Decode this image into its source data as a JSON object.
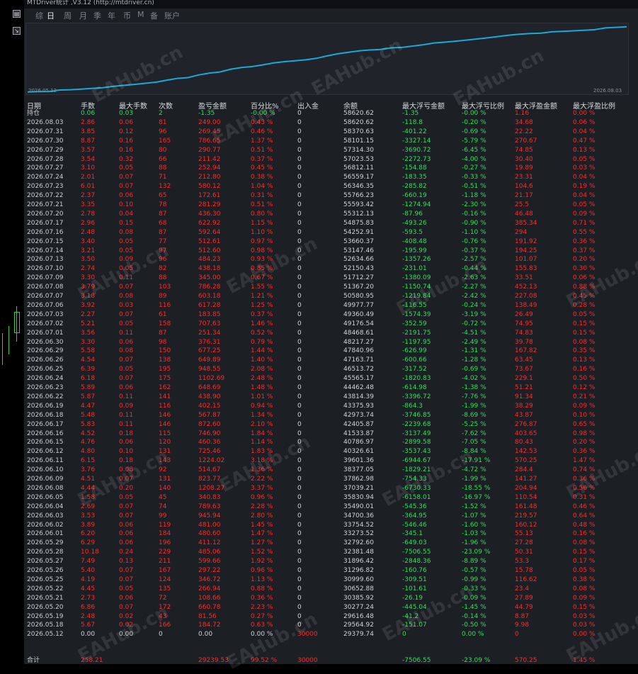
{
  "window": {
    "title": "MTDriver统计 ,V3.12 (http://mtdriver.cn)"
  },
  "tabs": [
    "综",
    "日",
    "周",
    "月",
    "季",
    "年",
    "币",
    "M",
    "备",
    "账户"
  ],
  "active_tab": "日",
  "chart": {
    "start_label": "2026.05.12",
    "end_label": "2026.08.03",
    "line_color": "#1aa9d6"
  },
  "columns": [
    "日期",
    "手数",
    "最大手数",
    "次数",
    "盈亏金额",
    "百分比%",
    "出入金",
    "余额",
    "最大浮亏金额",
    "最大浮亏比例",
    "最大浮盈金额",
    "最大浮盈比例"
  ],
  "holding": {
    "label": "持仓",
    "lots": "0.06",
    "max_lots": "0.03",
    "count": "2",
    "pnl": "-1.35",
    "pct": "-0.00 %",
    "io": "0",
    "balance": "58620.62",
    "max_float_loss": "-1.35",
    "max_float_loss_pct": "-0.00 %",
    "max_float_profit": "1.16",
    "max_float_profit_pct": "0.00 %"
  },
  "rows": [
    [
      "2026.08.03",
      "2.86",
      "0.06",
      "81",
      "249.00",
      "0.43 %",
      "0",
      "58620.62",
      "-118.8",
      "-0.20 %",
      "34.68",
      "0.06 %"
    ],
    [
      "2026.07.31",
      "3.85",
      "0.12",
      "96",
      "269.45",
      "0.46 %",
      "0",
      "58370.63",
      "-401.22",
      "-0.69 %",
      "22.22",
      "0.04 %"
    ],
    [
      "2026.07.30",
      "8.87",
      "0.16",
      "165",
      "786.65",
      "1.37 %",
      "0",
      "58101.15",
      "-3327.14",
      "-5.79 %",
      "270.67",
      "0.47 %"
    ],
    [
      "2026.07.29",
      "3.57",
      "0.16",
      "80",
      "290.77",
      "0.51 %",
      "0",
      "57314.30",
      "-3690.72",
      "-6.45 %",
      "74.85",
      "0.13 %"
    ],
    [
      "2026.07.28",
      "3.54",
      "0.32",
      "66",
      "211.42",
      "0.37 %",
      "0",
      "57023.53",
      "-2272.73",
      "-4.00 %",
      "30.40",
      "0.05 %"
    ],
    [
      "2026.07.27",
      "3.10",
      "0.05",
      "88",
      "252.94",
      "0.45 %",
      "0",
      "56812.11",
      "-154.88",
      "-0.27 %",
      "19.89",
      "0.03 %"
    ],
    [
      "2026.07.24",
      "2.01",
      "0.07",
      "71",
      "212.80",
      "0.38 %",
      "0",
      "56559.17",
      "-183.35",
      "-0.33 %",
      "23.31",
      "0.04 %"
    ],
    [
      "2026.07.23",
      "6.01",
      "0.07",
      "132",
      "580.12",
      "1.04 %",
      "0",
      "56346.35",
      "-285.82",
      "-0.51 %",
      "104.6",
      "0.19 %"
    ],
    [
      "2026.07.22",
      "2.37",
      "0.06",
      "65",
      "172.61",
      "0.31 %",
      "0",
      "55766.23",
      "-660.19",
      "-1.18 %",
      "21.17",
      "0.04 %"
    ],
    [
      "2026.07.21",
      "3.35",
      "0.10",
      "78",
      "281.29",
      "0.51 %",
      "0",
      "55593.42",
      "-1274.94",
      "-2.30 %",
      "25.5",
      "0.05 %"
    ],
    [
      "2026.07.20",
      "2.78",
      "0.04",
      "87",
      "436.30",
      "0.80 %",
      "0",
      "55312.13",
      "-87.96",
      "-0.16 %",
      "46.48",
      "0.09 %"
    ],
    [
      "2026.07.17",
      "2.96",
      "0.15",
      "68",
      "622.92",
      "1.15 %",
      "0",
      "54875.83",
      "-493.26",
      "-0.90 %",
      "385.34",
      "0.71 %"
    ],
    [
      "2026.07.16",
      "2.48",
      "0.08",
      "87",
      "592.64",
      "1.10 %",
      "0",
      "54252.91",
      "-593.5",
      "-1.10 %",
      "294",
      "0.55 %"
    ],
    [
      "2026.07.15",
      "3.40",
      "0.05",
      "77",
      "512.61",
      "0.97 %",
      "0",
      "53660.37",
      "-408.48",
      "-0.76 %",
      "191.92",
      "0.36 %"
    ],
    [
      "2026.07.14",
      "3.21",
      "0.05",
      "97",
      "512.60",
      "0.98 %",
      "0",
      "53147.46",
      "-195.99",
      "-0.37 %",
      "194.25",
      "0.37 %"
    ],
    [
      "2026.07.13",
      "3.50",
      "0.09",
      "96",
      "484.23",
      "0.93 %",
      "0",
      "52634.66",
      "-1357.26",
      "-2.57 %",
      "101.07",
      "0.20 %"
    ],
    [
      "2026.07.10",
      "2.74",
      "0.05",
      "82",
      "438.18",
      "0.85 %",
      "0",
      "52150.43",
      "-231.01",
      "-0.44 %",
      "155.83",
      "0.30 %"
    ],
    [
      "2026.07.09",
      "3.30",
      "0.11",
      "88",
      "345.00",
      "0.67 %",
      "0",
      "51712.27",
      "-1380.09",
      "-2.63 %",
      "33.51",
      "0.06 %"
    ],
    [
      "2026.07.08",
      "3.79",
      "0.07",
      "103",
      "786.28",
      "1.55 %",
      "0",
      "51367.20",
      "-1150.74",
      "-2.27 %",
      "452.13",
      "0.88 %"
    ],
    [
      "2026.07.07",
      "3.18",
      "0.08",
      "89",
      "603.18",
      "1.21 %",
      "0",
      "50580.95",
      "-1219.84",
      "-2.42 %",
      "227.08",
      "0.45 %"
    ],
    [
      "2026.07.06",
      "3.92",
      "0.03",
      "116",
      "617.28",
      "1.25 %",
      "0",
      "49977.77",
      "-116.55",
      "-0.24 %",
      "138.49",
      "0.28 %"
    ],
    [
      "2026.07.03",
      "2.27",
      "0.07",
      "61",
      "183.85",
      "0.37 %",
      "0",
      "49360.49",
      "-1574.39",
      "-3.19 %",
      "26.49",
      "0.05 %"
    ],
    [
      "2026.07.02",
      "5.21",
      "0.05",
      "158",
      "707.63",
      "1.46 %",
      "0",
      "49176.54",
      "-352.59",
      "-0.72 %",
      "74.95",
      "0.15 %"
    ],
    [
      "2026.07.01",
      "3.56",
      "0.11",
      "87",
      "251.34",
      "0.52 %",
      "0",
      "48468.61",
      "-2191.75",
      "-4.51 %",
      "74.83",
      "0.15 %"
    ],
    [
      "2026.06.30",
      "3.30",
      "0.06",
      "98",
      "376.31",
      "0.79 %",
      "0",
      "48217.27",
      "-1197.95",
      "-2.49 %",
      "39.78",
      "0.08 %"
    ],
    [
      "2026.06.29",
      "5.58",
      "0.08",
      "150",
      "677.25",
      "1.44 %",
      "0",
      "47840.96",
      "-626.99",
      "-1.31 %",
      "167.82",
      "0.35 %"
    ],
    [
      "2026.06.26",
      "4.54",
      "0.07",
      "138",
      "649.89",
      "1.40 %",
      "0",
      "47163.71",
      "-600.66",
      "-1.28 %",
      "63.45",
      "0.13 %"
    ],
    [
      "2026.06.25",
      "6.39",
      "0.05",
      "195",
      "948.55",
      "2.08 %",
      "0",
      "46513.72",
      "-317.52",
      "-0.69 %",
      "73.67",
      "0.16 %"
    ],
    [
      "2026.06.24",
      "6.18",
      "0.07",
      "175",
      "1102.69",
      "2.48 %",
      "0",
      "45565.17",
      "-1820.83",
      "-4.02 %",
      "229.1",
      "0.50 %"
    ],
    [
      "2026.06.23",
      "5.89",
      "0.06",
      "162",
      "648.69",
      "1.48 %",
      "0",
      "44462.48",
      "-614.98",
      "-1.38 %",
      "51.21",
      "0.12 %"
    ],
    [
      "2026.06.22",
      "5.87",
      "0.11",
      "141",
      "438.90",
      "1.01 %",
      "0",
      "43814.39",
      "-3396.72",
      "-7.76 %",
      "91.34",
      "0.21 %"
    ],
    [
      "2026.06.19",
      "4.47",
      "0.09",
      "116",
      "402.15",
      "0.94 %",
      "0",
      "43375.93",
      "-864.3",
      "-1.99 %",
      "38.29",
      "0.09 %"
    ],
    [
      "2026.06.18",
      "5.48",
      "0.11",
      "146",
      "567.87",
      "1.34 %",
      "0",
      "42973.74",
      "-3746.85",
      "-8.69 %",
      "43.87",
      "0.10 %"
    ],
    [
      "2026.06.17",
      "5.83",
      "0.11",
      "146",
      "872.60",
      "2.10 %",
      "0",
      "42405.87",
      "-2239.68",
      "-5.25 %",
      "276.87",
      "0.65 %"
    ],
    [
      "2026.06.16",
      "4.52",
      "0.18",
      "115",
      "746.90",
      "1.84 %",
      "0",
      "41533.87",
      "-3137.49",
      "-7.62 %",
      "403.65",
      "0.98 %"
    ],
    [
      "2026.06.15",
      "4.76",
      "0.06",
      "120",
      "460.36",
      "1.14 %",
      "0",
      "40786.97",
      "-2899.58",
      "-7.05 %",
      "80.43",
      "0.20 %"
    ],
    [
      "2026.06.12",
      "4.80",
      "0.10",
      "131",
      "725.46",
      "1.83 %",
      "0",
      "40326.61",
      "-3537.43",
      "-8.84 %",
      "142.53",
      "0.36 %"
    ],
    [
      "2026.06.11",
      "6.15",
      "0.18",
      "143",
      "1224.02",
      "3.18 %",
      "0",
      "39601.36",
      "-6944.67",
      "-17.91 %",
      "570.25",
      "1.47 %"
    ],
    [
      "2026.06.10",
      "3.76",
      "0.08",
      "92",
      "514.67",
      "1.36 %",
      "0",
      "38377.05",
      "-1829.21",
      "-4.72 %",
      "284.4",
      "0.74 %"
    ],
    [
      "2026.06.09",
      "4.51",
      "0.07",
      "131",
      "823.77",
      "2.22 %",
      "0",
      "37862.98",
      "-754.33",
      "-1.99 %",
      "141.27",
      "0.36 %"
    ],
    [
      "2026.06.08",
      "4.44",
      "0.20",
      "140",
      "1208.27",
      "3.37 %",
      "0",
      "37039.21",
      "-6730.33",
      "-18.55 %",
      "204.94",
      "0.56 %"
    ],
    [
      "2026.06.05",
      "1.58",
      "0.05",
      "45",
      "340.83",
      "0.96 %",
      "0",
      "35830.94",
      "-6158.01",
      "-16.97 %",
      "110.54",
      "0.31 %"
    ],
    [
      "2026.06.04",
      "2.69",
      "0.07",
      "74",
      "789.63",
      "2.28 %",
      "0",
      "35490.01",
      "-545.36",
      "-1.52 %",
      "161.48",
      "0.46 %"
    ],
    [
      "2026.06.03",
      "3.53",
      "0.07",
      "99",
      "945.94",
      "2.80 %",
      "0",
      "34700.36",
      "-364.95",
      "-1.07 %",
      "219.57",
      "0.64 %"
    ],
    [
      "2026.06.02",
      "3.89",
      "0.06",
      "119",
      "481.00",
      "1.45 %",
      "0",
      "33754.52",
      "-546.46",
      "-1.60 %",
      "160.12",
      "0.48 %"
    ],
    [
      "2026.06.01",
      "6.20",
      "0.06",
      "184",
      "480.60",
      "1.47 %",
      "0",
      "33273.52",
      "-345.1",
      "-1.03 %",
      "55.13",
      "0.16 %"
    ],
    [
      "2026.05.29",
      "6.29",
      "0.06",
      "196",
      "411.12",
      "1.27 %",
      "0",
      "32792.60",
      "-649.03",
      "-1.96 %",
      "27.28",
      "0.08 %"
    ],
    [
      "2026.05.28",
      "10.18",
      "0.24",
      "229",
      "485.06",
      "1.52 %",
      "0",
      "32381.48",
      "-7506.55",
      "-23.09 %",
      "50.31",
      "0.15 %"
    ],
    [
      "2026.05.27",
      "7.49",
      "0.13",
      "211",
      "599.66",
      "1.92 %",
      "0",
      "31896.42",
      "-2848.36",
      "-8.89 %",
      "53.3",
      "0.17 %"
    ],
    [
      "2026.05.26",
      "5.40",
      "0.07",
      "167",
      "297.22",
      "0.96 %",
      "0",
      "31296.82",
      "-160.76",
      "-0.57 %",
      "15.78",
      "0.05 %"
    ],
    [
      "2026.05.25",
      "4.19",
      "0.07",
      "124",
      "346.72",
      "1.13 %",
      "0",
      "30999.60",
      "-309.51",
      "-0.99 %",
      "116.62",
      "0.38 %"
    ],
    [
      "2026.05.22",
      "4.45",
      "0.05",
      "135",
      "266.94",
      "0.88 %",
      "0",
      "30652.88",
      "-101.61",
      "-0.33 %",
      "23.4",
      "0.08 %"
    ],
    [
      "2026.05.21",
      "2.73",
      "0.06",
      "72",
      "108.66",
      "0.36 %",
      "0",
      "30385.92",
      "-26.19",
      "-0.09 %",
      "27.89",
      "0.09 %"
    ],
    [
      "2026.05.20",
      "6.86",
      "0.07",
      "172",
      "660.78",
      "2.23 %",
      "0",
      "30277.24",
      "-445.04",
      "-1.45 %",
      "44.79",
      "0.15 %"
    ],
    [
      "2026.05.19",
      "2.48",
      "0.02",
      "43",
      "81.56",
      "0.27 %",
      "0",
      "29616.48",
      "-41.2",
      "-0.14 %",
      "8.87",
      "0.03 %"
    ],
    [
      "2026.05.18",
      "5.67",
      "0.02",
      "166",
      "184.72",
      "0.63 %",
      "0",
      "29564.92",
      "-151.07",
      "-0.50 %",
      "9.98",
      "0.03 %"
    ],
    [
      "2026.05.12",
      "0.00",
      "0.00",
      "0",
      "0.00",
      "0.00 %",
      "30000",
      "29379.74",
      "0",
      "0.00 %",
      "0",
      "0.00 %"
    ]
  ],
  "total": {
    "label": "合计",
    "lots": "258.21",
    "pnl": "29239.53",
    "pct": "99.52 %",
    "io": "30000",
    "max_float_loss": "-7506.55",
    "max_float_loss_pct": "-23.09 %",
    "max_float_profit": "570.25",
    "max_float_profit_pct": "1.45 %"
  },
  "watermark": "EAHub.cn"
}
